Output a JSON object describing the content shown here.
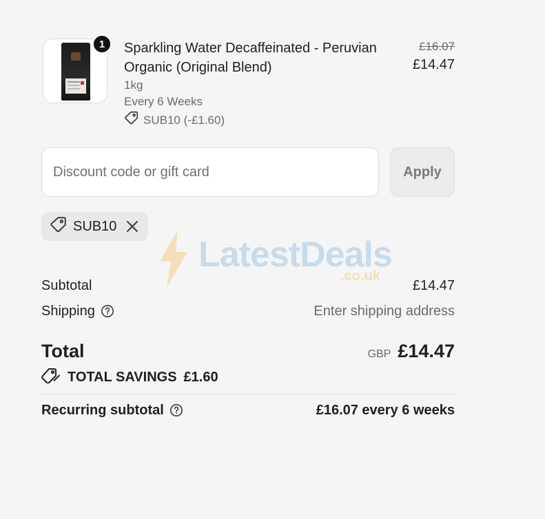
{
  "product": {
    "quantity": "1",
    "title": "Sparkling Water Decaffeinated - Peruvian Organic (Original Blend)",
    "size": "1kg",
    "frequency": "Every 6 Weeks",
    "discount_applied": "SUB10 (-£1.60)",
    "price_original": "£16.07",
    "price_current": "£14.47"
  },
  "discount": {
    "placeholder": "Discount code or gift card",
    "value": "",
    "apply_label": "Apply"
  },
  "applied_code": {
    "code": "SUB10"
  },
  "summary": {
    "subtotal_label": "Subtotal",
    "subtotal_value": "£14.47",
    "shipping_label": "Shipping",
    "shipping_value": "Enter shipping address",
    "total_label": "Total",
    "total_currency": "GBP",
    "total_value": "£14.47",
    "savings_label": "TOTAL SAVINGS",
    "savings_value": "£1.60",
    "recurring_label": "Recurring subtotal",
    "recurring_value": "£16.07 every 6 weeks"
  },
  "watermark": {
    "name": "LatestDeals",
    "domain": ".co.uk"
  },
  "icons": {
    "tag": "tag-icon",
    "close": "close-icon",
    "help": "question-circle-icon",
    "savings": "double-tag-icon",
    "watermark_bolt": "lightning-bolt-icon"
  },
  "colors": {
    "background": "#f5f5f5",
    "text": "#1f1f1f",
    "muted": "#6b6b6b",
    "badge": "#111111"
  }
}
